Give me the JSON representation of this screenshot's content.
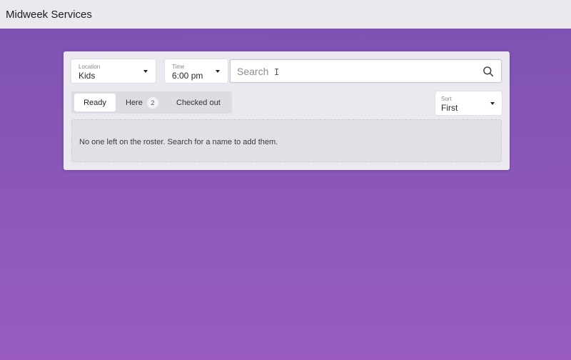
{
  "app": {
    "title": "Midweek Services"
  },
  "filters": {
    "location": {
      "label": "Location",
      "value": "Kids"
    },
    "time": {
      "label": "Time",
      "value": "6:00 pm"
    },
    "search": {
      "placeholder": "Search",
      "value": ""
    }
  },
  "tabs": [
    {
      "label": "Ready",
      "active": true
    },
    {
      "label": "Here",
      "count": "2"
    },
    {
      "label": "Checked out"
    }
  ],
  "sort": {
    "label": "Sort",
    "value": "First"
  },
  "roster": {
    "empty_message": "No one left on the roster. Search for a name to add them."
  },
  "colors": {
    "accent_purple": "#8a57b9",
    "card_bg": "#ebe9ef",
    "topbar_bg": "#ebe9ee"
  }
}
